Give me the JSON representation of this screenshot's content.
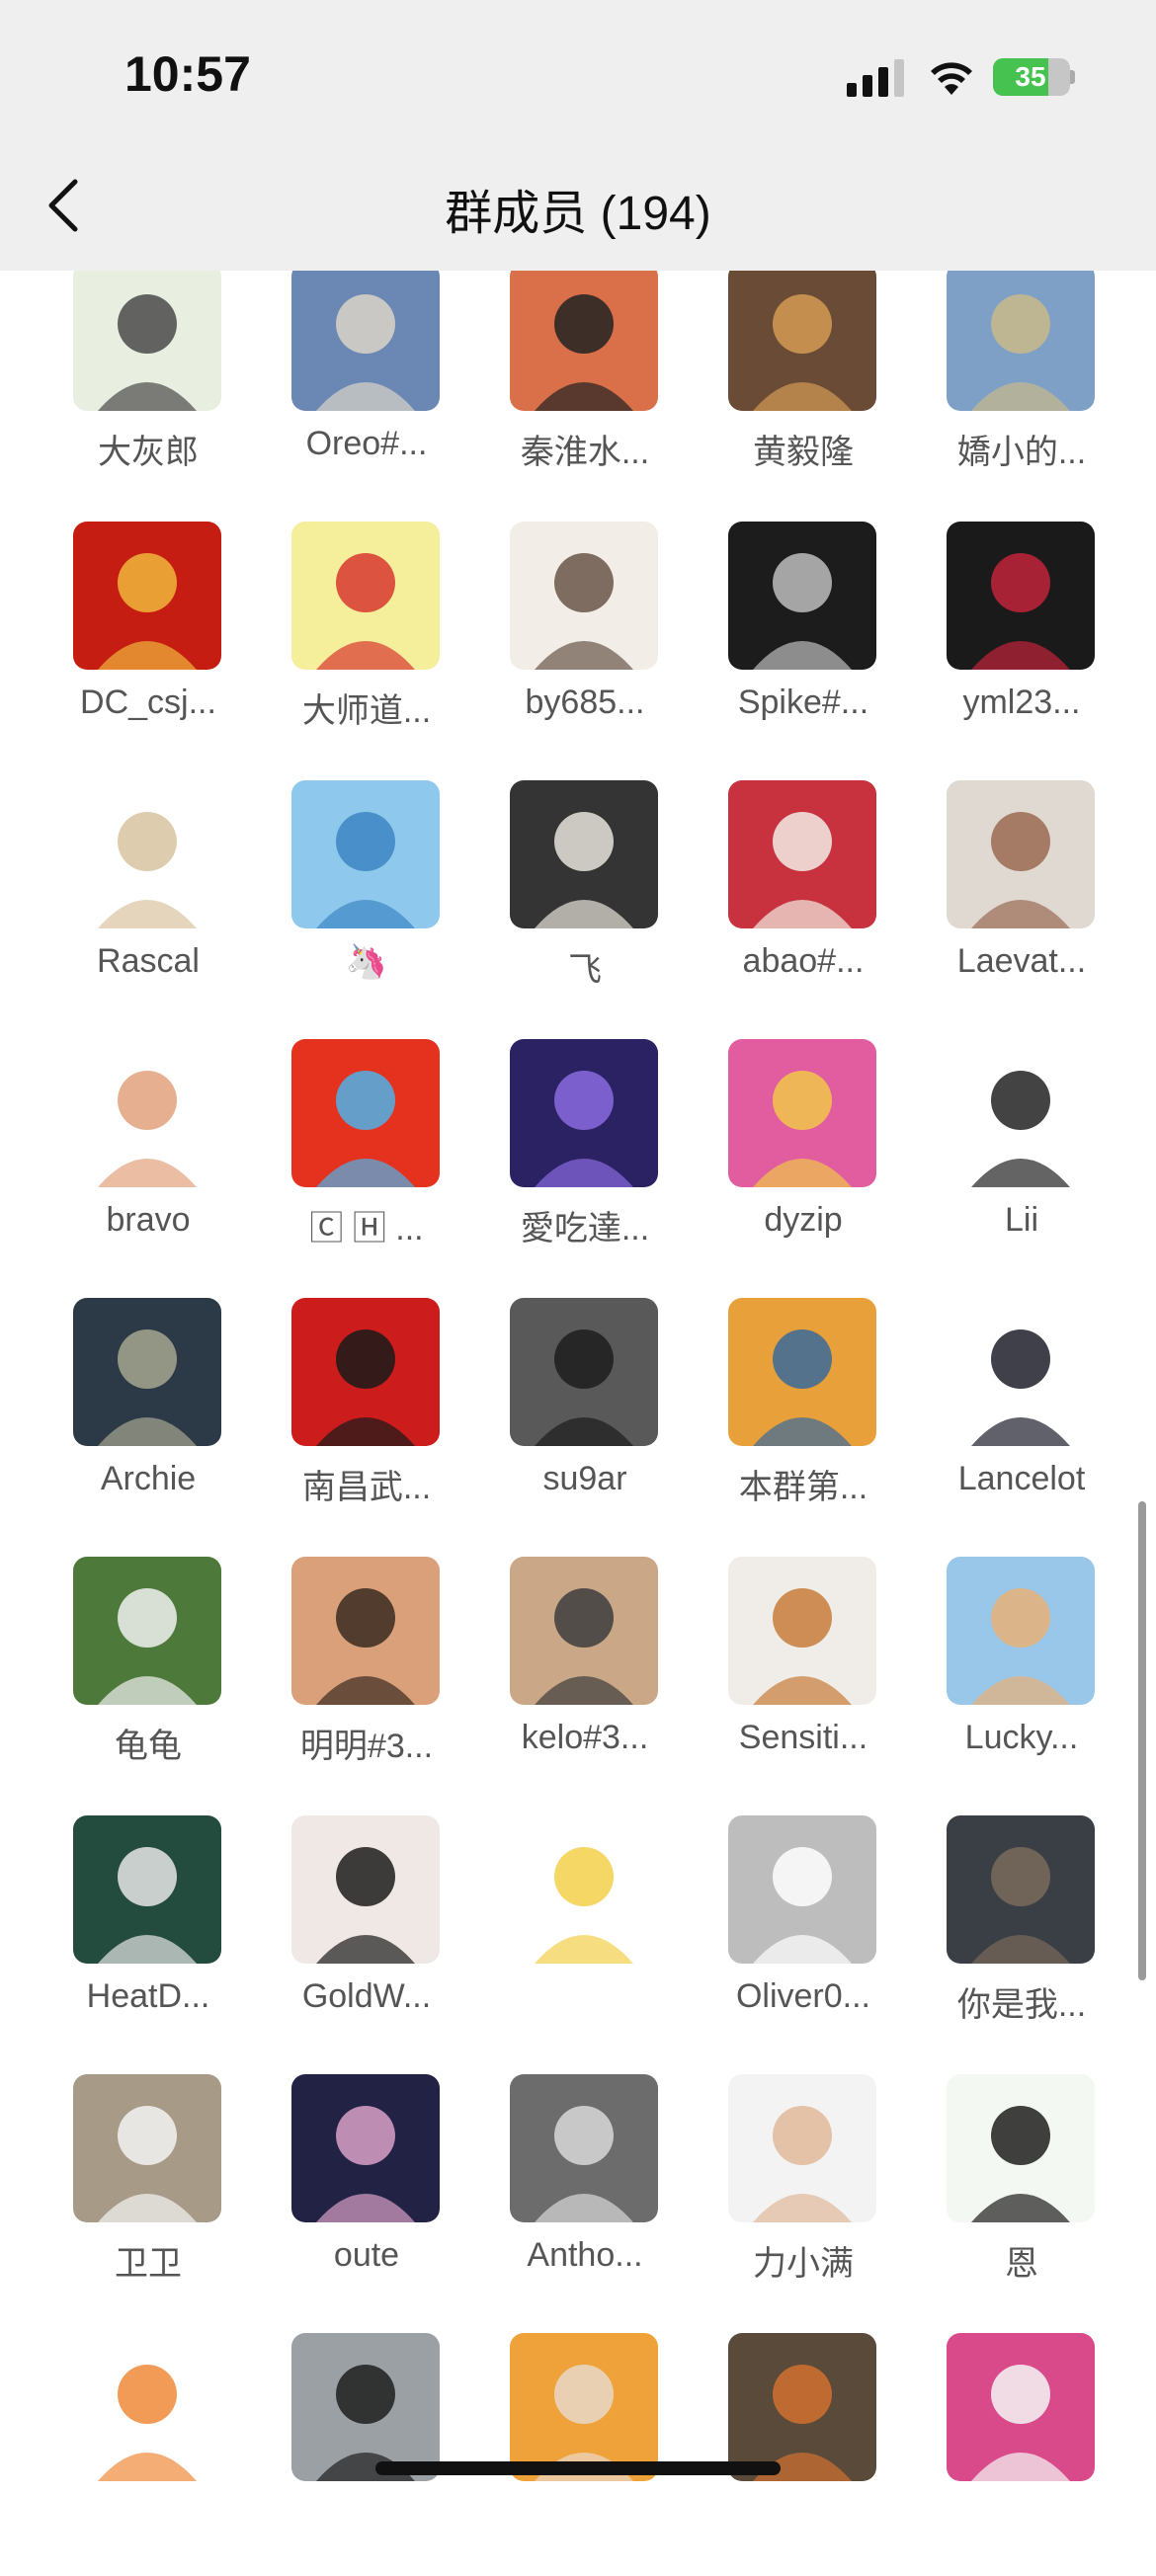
{
  "status": {
    "time": "10:57",
    "battery": "35"
  },
  "nav": {
    "title": "群成员 (194)"
  },
  "icons": {
    "back": "chevron-left-icon",
    "signal": "cellular-signal-icon",
    "wifi": "wifi-icon",
    "battery": "battery-icon"
  },
  "members": [
    {
      "name": "大灰郎",
      "c1": "#e9efe0",
      "c2": "#4a4a4a"
    },
    {
      "name": "Oreo#...",
      "c1": "#6b88b5",
      "c2": "#d9d4c8"
    },
    {
      "name": "秦淮水...",
      "c1": "#d9704a",
      "c2": "#222"
    },
    {
      "name": "黄毅隆",
      "c1": "#6a4b36",
      "c2": "#d49a54"
    },
    {
      "name": "嬌小的...",
      "c1": "#7ea0c7",
      "c2": "#c9b98a"
    },
    {
      "name": "DC_csj...",
      "c1": "#c61d12",
      "c2": "#f0b63c"
    },
    {
      "name": "大师道...",
      "c1": "#f5ee9a",
      "c2": "#d7382f"
    },
    {
      "name": "by685...",
      "c1": "#f2ede6",
      "c2": "#6a5548"
    },
    {
      "name": "Spike#...",
      "c1": "#1c1c1c",
      "c2": "#bdbdbd"
    },
    {
      "name": "yml23...",
      "c1": "#1a1a1a",
      "c2": "#c0243a"
    },
    {
      "name": "Rascal",
      "c1": "#ffffff",
      "c2": "#d8c3a0"
    },
    {
      "name": "🦄",
      "c1": "#8ec8ec",
      "c2": "#3d86c4"
    },
    {
      "name": "飞",
      "c1": "#343434",
      "c2": "#e8e4dc"
    },
    {
      "name": "abao#...",
      "c1": "#c7323e",
      "c2": "#f3ece4"
    },
    {
      "name": "Laevat...",
      "c1": "#e0d9d2",
      "c2": "#9a6a54"
    },
    {
      "name": "bravo",
      "c1": "#ffffff",
      "c2": "#e2a27c"
    },
    {
      "name": "🄲 🄷 ...",
      "c1": "#e4321f",
      "c2": "#4fb1e8"
    },
    {
      "name": "愛吃達...",
      "c1": "#2a2262",
      "c2": "#8a6ae0"
    },
    {
      "name": "dyzip",
      "c1": "#e25ca0",
      "c2": "#f1c64a"
    },
    {
      "name": "Lii",
      "c1": "#ffffff",
      "c2": "#222"
    },
    {
      "name": "Archie",
      "c1": "#2c3a48",
      "c2": "#a7a790"
    },
    {
      "name": "南昌武...",
      "c1": "#cc1c1c",
      "c2": "#1a1a1a"
    },
    {
      "name": "su9ar",
      "c1": "#595959",
      "c2": "#1d1d1d"
    },
    {
      "name": "本群第...",
      "c1": "#e8a03a",
      "c2": "#3a6a9a"
    },
    {
      "name": "Lancelot",
      "c1": "#ffffff",
      "c2": "#1e1e2c"
    },
    {
      "name": "龟龟",
      "c1": "#4d7a3a",
      "c2": "#f1f1f1"
    },
    {
      "name": "明明#3...",
      "c1": "#d9a07a",
      "c2": "#3a2a20"
    },
    {
      "name": "kelo#3...",
      "c1": "#caa786",
      "c2": "#3d3d3d"
    },
    {
      "name": "Sensiti...",
      "c1": "#f0ede8",
      "c2": "#c87b3a"
    },
    {
      "name": "Lucky...",
      "c1": "#99c7ea",
      "c2": "#e8b078"
    },
    {
      "name": "HeatD...",
      "c1": "#244c3e",
      "c2": "#e6e6e6"
    },
    {
      "name": "GoldW...",
      "c1": "#efe8e4",
      "c2": "#1c1c1c"
    },
    {
      "name": "",
      "c1": "#ffffff",
      "c2": "#f2d04a"
    },
    {
      "name": "Oliver0...",
      "c1": "#bdbdbd",
      "c2": "#ffffff"
    },
    {
      "name": "你是我...",
      "c1": "#3a3f45",
      "c2": "#7a6a5a"
    },
    {
      "name": "卫卫",
      "c1": "#a79a86",
      "c2": "#f3f3f3"
    },
    {
      "name": "oute",
      "c1": "#222244",
      "c2": "#d8a0c8"
    },
    {
      "name": "Antho...",
      "c1": "#6c6c6c",
      "c2": "#d8d8d8"
    },
    {
      "name": "力小满",
      "c1": "#f3f3f3",
      "c2": "#e0b89a"
    },
    {
      "name": "恩",
      "c1": "#f4f8f2",
      "c2": "#1e1e1e"
    },
    {
      "name": "",
      "c1": "#ffffff",
      "c2": "#f08a3a"
    },
    {
      "name": "",
      "c1": "#9aa0a4",
      "c2": "#1e1e1e"
    },
    {
      "name": "",
      "c1": "#f0a23a",
      "c2": "#e8d8c8"
    },
    {
      "name": "",
      "c1": "#5a4a3a",
      "c2": "#d07030"
    },
    {
      "name": "",
      "c1": "#d84a8a",
      "c2": "#f6f6f6"
    }
  ]
}
